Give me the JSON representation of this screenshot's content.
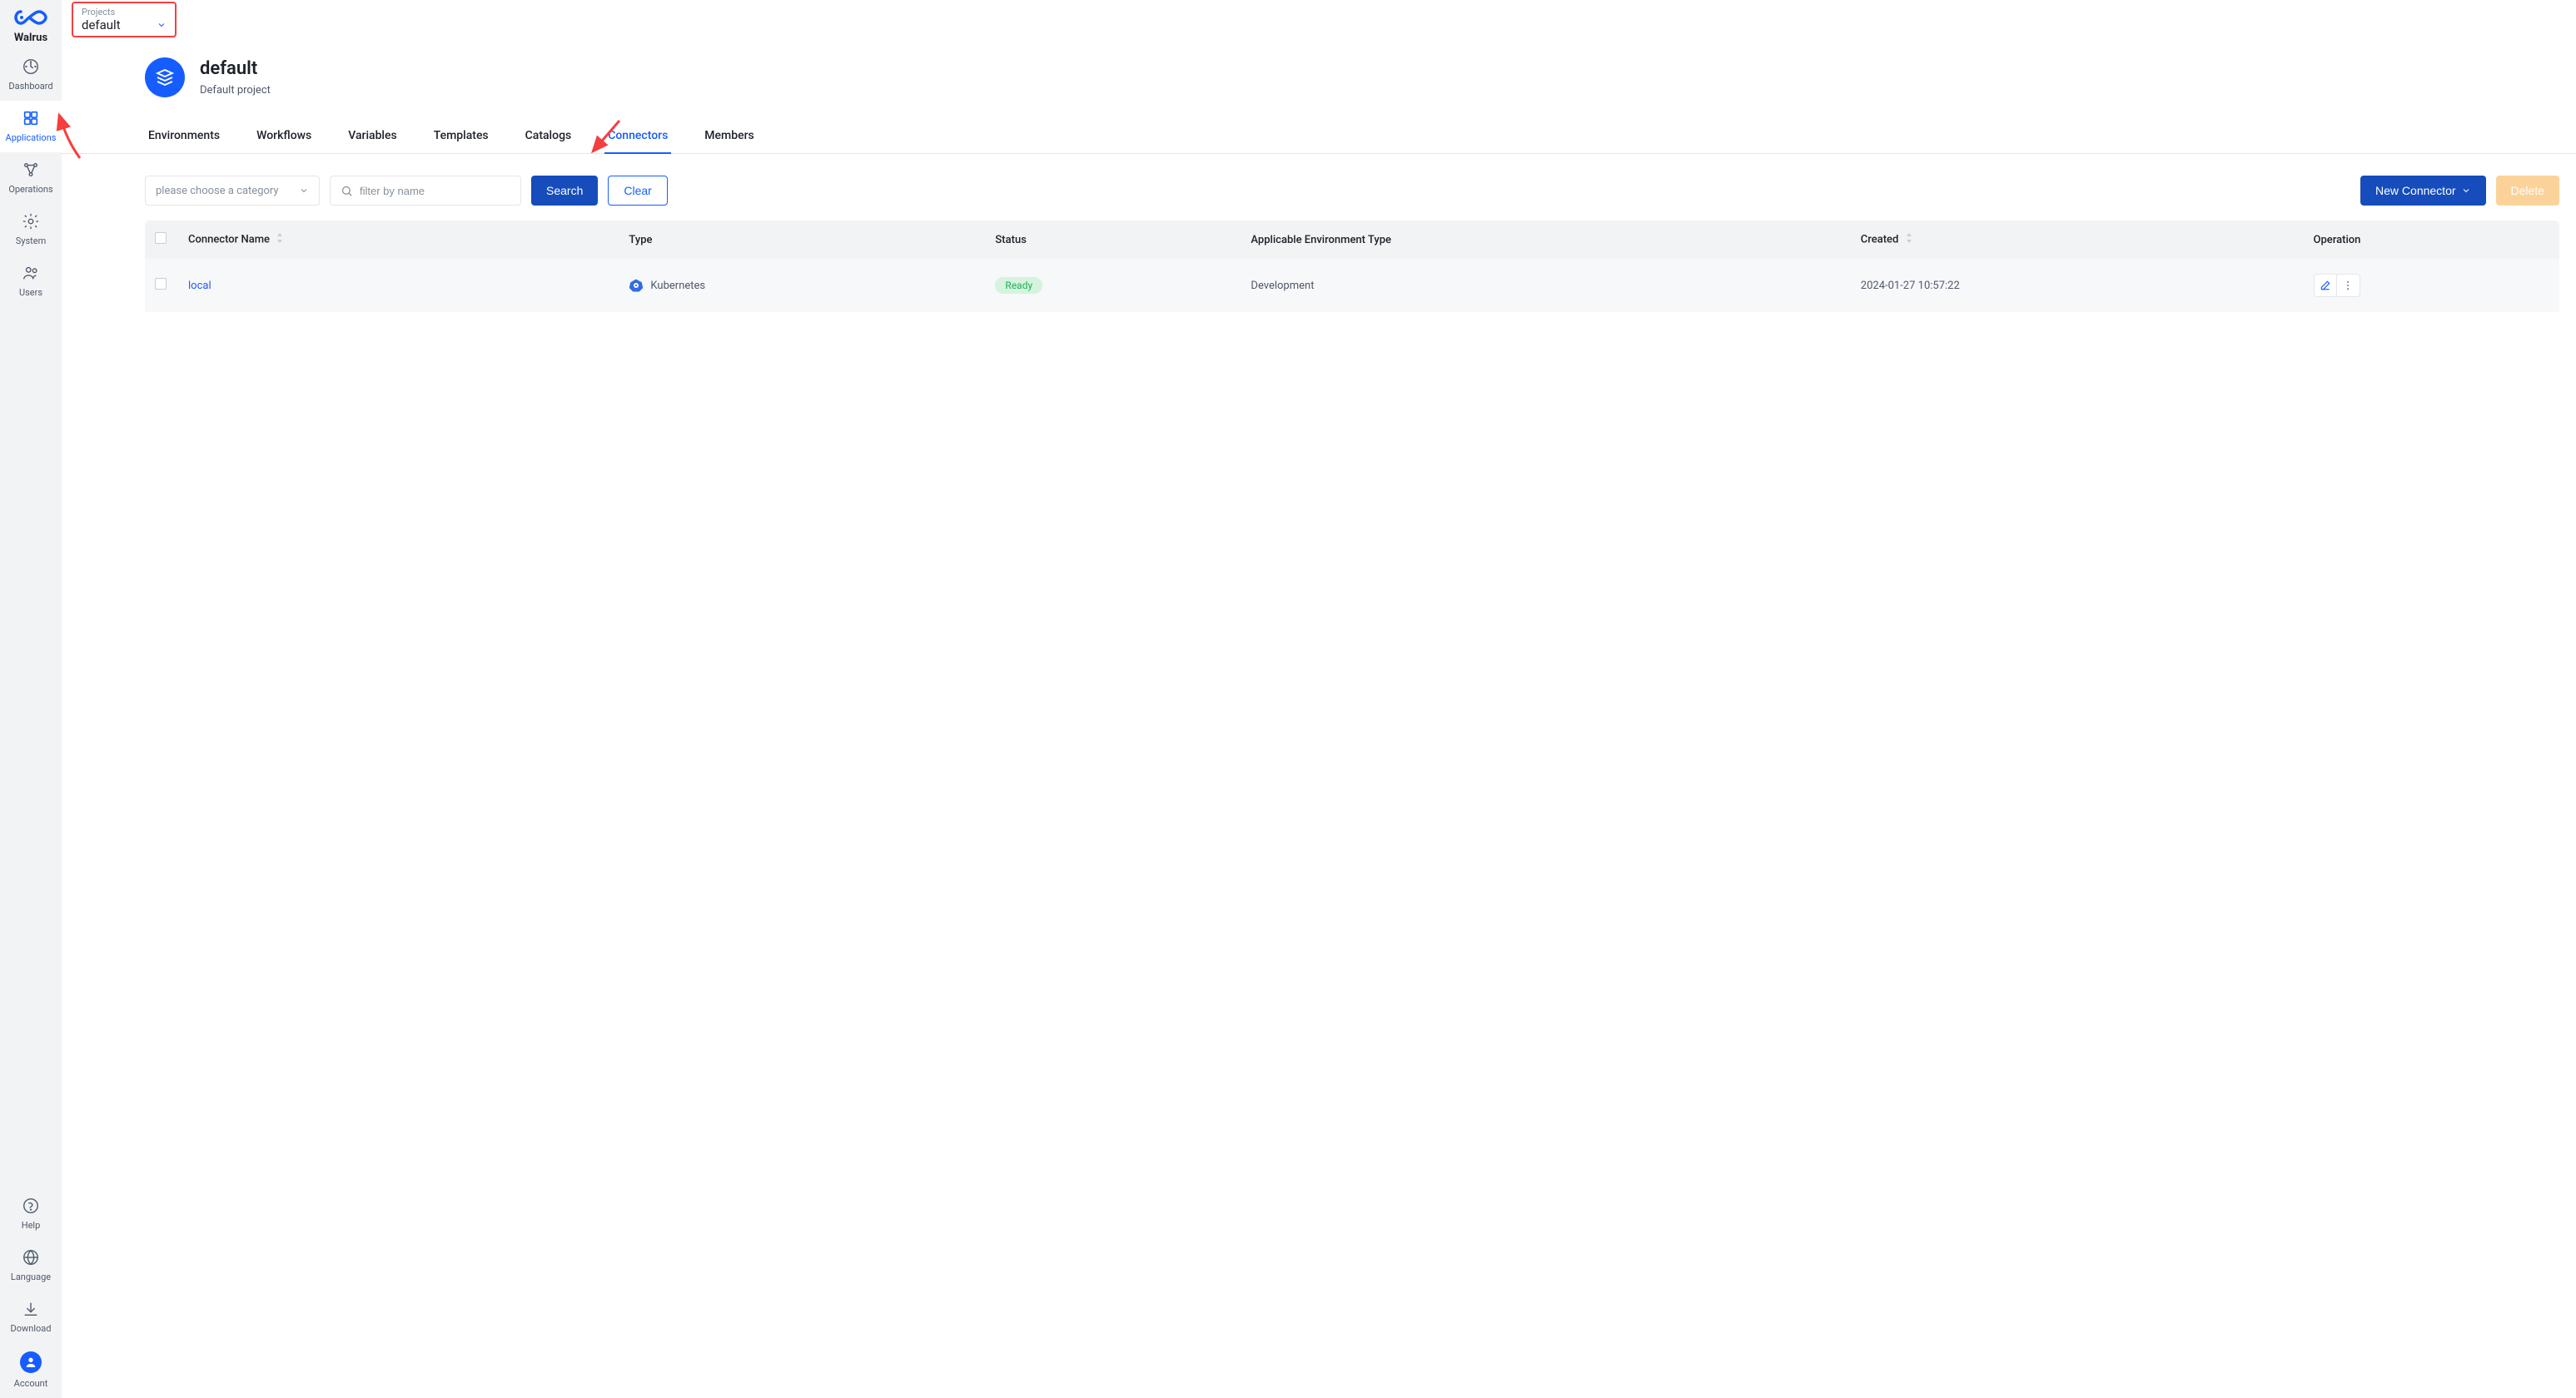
{
  "brand": {
    "name": "Walrus"
  },
  "sidebar": {
    "top": [
      {
        "label": "Dashboard"
      },
      {
        "label": "Applications"
      },
      {
        "label": "Operations"
      },
      {
        "label": "System"
      },
      {
        "label": "Users"
      }
    ],
    "bottom": [
      {
        "label": "Help"
      },
      {
        "label": "Language"
      },
      {
        "label": "Download"
      },
      {
        "label": "Account"
      }
    ]
  },
  "project_selector": {
    "label": "Projects",
    "value": "default"
  },
  "page": {
    "title": "default",
    "subtitle": "Default project"
  },
  "tabs": [
    {
      "label": "Environments"
    },
    {
      "label": "Workflows"
    },
    {
      "label": "Variables"
    },
    {
      "label": "Templates"
    },
    {
      "label": "Catalogs"
    },
    {
      "label": "Connectors"
    },
    {
      "label": "Members"
    }
  ],
  "toolbar": {
    "category_placeholder": "please choose a category",
    "filter_placeholder": "filter by name",
    "search": "Search",
    "clear": "Clear",
    "new_connector": "New Connector",
    "delete": "Delete"
  },
  "table": {
    "columns": {
      "name": "Connector Name",
      "type": "Type",
      "status": "Status",
      "env_type": "Applicable Environment Type",
      "created": "Created",
      "operation": "Operation"
    },
    "rows": [
      {
        "name": "local",
        "type": "Kubernetes",
        "status": "Ready",
        "env_type": "Development",
        "created": "2024-01-27 10:57:22"
      }
    ]
  }
}
